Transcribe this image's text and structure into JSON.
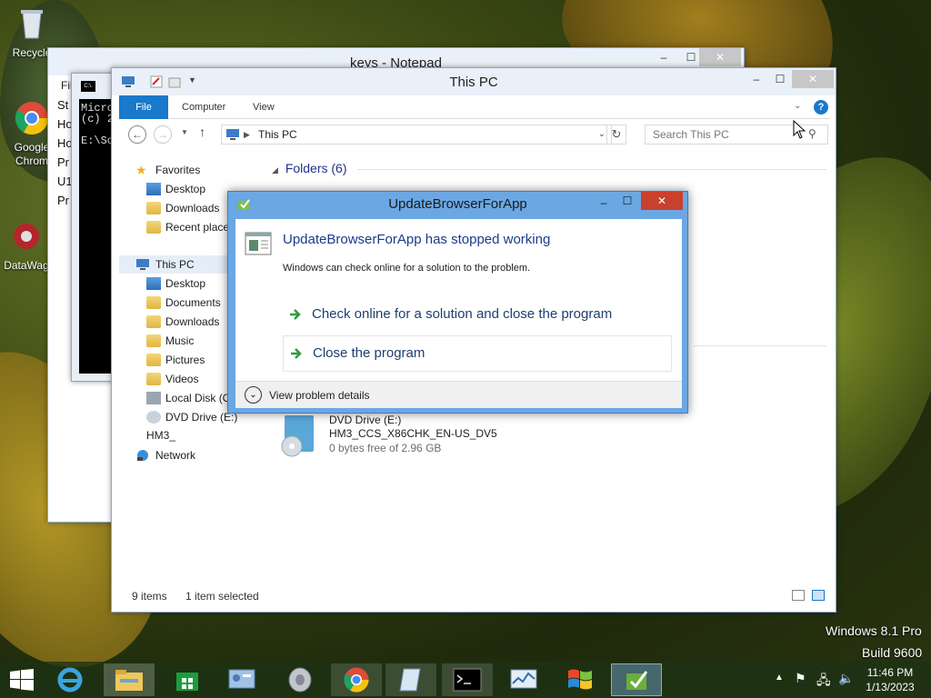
{
  "desktop": {
    "icons": [
      {
        "label": "Recycle",
        "icon": "recycle-bin-icon"
      },
      {
        "label": "Google Chrom",
        "icon": "chrome-icon"
      },
      {
        "label": "DataWag",
        "icon": "datawag-icon"
      }
    ],
    "watermark_line1": "Windows 8.1 Pro",
    "watermark_line2": "Build 9600"
  },
  "notepad": {
    "title": "keys - Notepad",
    "menu_file": "Fil",
    "lines": [
      "St",
      "Ho",
      "Ho",
      "Pr",
      "U1",
      "Pr"
    ]
  },
  "cmd": {
    "title": "C:\\.",
    "lines": [
      "Micro",
      "(c) 2",
      "",
      "E:\\So"
    ]
  },
  "explorer": {
    "title": "This PC",
    "tabs": [
      "File",
      "Computer",
      "View"
    ],
    "address": "This PC",
    "search_placeholder": "Search This PC",
    "nav": {
      "favorites": "Favorites",
      "favorites_items": [
        "Desktop",
        "Downloads",
        "Recent places"
      ],
      "this_pc": "This PC",
      "this_pc_items": [
        "Desktop",
        "Documents",
        "Downloads",
        "Music",
        "Pictures",
        "Videos",
        "Local Disk (C",
        "DVD Drive (E:) HM3_"
      ],
      "network": "Network"
    },
    "folders_header": "Folders (6)",
    "dvd": {
      "name": "DVD Drive (E:)",
      "label": "HM3_CCS_X86CHK_EN-US_DV5",
      "free": "0 bytes free of 2.96 GB"
    },
    "status_items": "9 items",
    "status_selected": "1 item selected"
  },
  "dialog": {
    "title": "UpdateBrowserForApp",
    "heading": "UpdateBrowserForApp has stopped working",
    "message": "Windows can check online for a solution to the problem.",
    "option1": "Check online for a solution and close the program",
    "option2": "Close the program",
    "details": "View problem details"
  },
  "tray": {
    "time": "11:46 PM",
    "date": "1/13/2023"
  },
  "colors": {
    "accent": "#1979ca",
    "dialog_frame": "#6aa7e3",
    "close_red": "#c7412e",
    "link_text": "#1e3f6e"
  }
}
